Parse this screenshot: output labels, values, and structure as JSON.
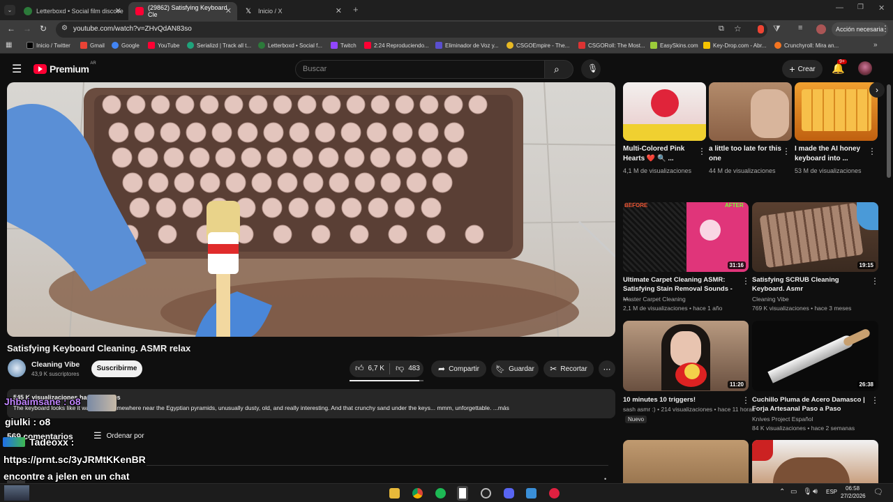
{
  "browser": {
    "tabs": [
      {
        "title": "Letterboxd • Social film discove",
        "color": "#2c7a3a"
      },
      {
        "title": "(29862) Satisfying Keyboard Cle",
        "color": "#ff0033"
      },
      {
        "title": "Inicio / X",
        "color": "#ffffff"
      }
    ],
    "url": "youtube.com/watch?v=ZHvQdAN83so",
    "profile_label": "Acción necesaria",
    "bookmarks": [
      "Inicio / Twitter",
      "Gmail",
      "Google",
      "YouTube",
      "Serializd | Track all t...",
      "Letterboxd • Social f...",
      "Twitch",
      "2:24 Reproduciendo...",
      "Eliminador de Voz y...",
      "CSGOEmpire - The...",
      "CSGORoll: The Most...",
      "EasySkins.com",
      "Key-Drop.com - Abr...",
      "Crunchyroll: Mira an..."
    ]
  },
  "yt": {
    "logo": "Premium",
    "region": "AR",
    "search_placeholder": "Buscar",
    "create_label": "Crear",
    "notif_count": "9+"
  },
  "video": {
    "title": "Satisfying Keyboard Cleaning. ASMR relax",
    "channel": "Cleaning Vibe",
    "subscribers": "43,9 K suscriptores",
    "subscribe_label": "Suscribirme",
    "likes": "6,7 K",
    "dislikes": "483",
    "share_label": "Compartir",
    "save_label": "Guardar",
    "clip_label": "Recortar",
    "desc_stats": "545 K visualizaciones  hace 3 meses",
    "desc_text": "The keyboard looks like it was found somewhere near the Egyptian pyramids,  unusually dusty, old, and really interesting. And that crunchy sand under the keys... mmm, unforgettable. ...más",
    "comments_count": "569 comentarios",
    "sort_label": "Ordenar por"
  },
  "overlay_chat": {
    "line1": "Jhbaimsane : o8",
    "line2": "giulki : o8",
    "line3_name": "Tadeoxx :",
    "line4": "https://prnt.sc/3yJRMtKKenBR",
    "line5": "encontre a jelen en un chat"
  },
  "sidebar_top": [
    {
      "title": "Multi-Colored Pink Hearts ❤️ 🔍 ...",
      "meta": "4,1 M de visualizaciones"
    },
    {
      "title": "a little too late for this one",
      "meta": "44 M de visualizaciones"
    },
    {
      "title": "I made the AI honey keyboard into ...",
      "meta": "53 M de visualizaciones"
    }
  ],
  "sidebar_grid": [
    {
      "title": "Ultimate Carpet Cleaning ASMR: Satisfying Stain Removal Sounds - ...",
      "channel": "Master Carpet Cleaning",
      "stats": "2,1 M de visualizaciones • hace 1 año",
      "duration": "31:16",
      "badge_left": "BEFORE",
      "badge_right": "AFTER"
    },
    {
      "title": "Satisfying SCRUB Cleaning Keyboard. Asmr",
      "channel": "Cleaning Vibe",
      "stats": "769 K visualizaciones • hace 3 meses",
      "duration": "19:15"
    },
    {
      "title": "10 minutes 10 triggers!",
      "channel": "sash asmr :)",
      "stats": "214 visualizaciones • hace 11 horas",
      "badge": "Nuevo",
      "duration": "11:20"
    },
    {
      "title": "Cuchillo Pluma de Acero Damasco | Forja Artesanal Paso a Paso",
      "channel": "Knives Project Español",
      "stats": "84 K visualizaciones • hace 2 semanas",
      "duration": "26:38"
    }
  ],
  "taskbar": {
    "lang": "ESP",
    "time": "06:58",
    "date": "27/2/2026"
  }
}
